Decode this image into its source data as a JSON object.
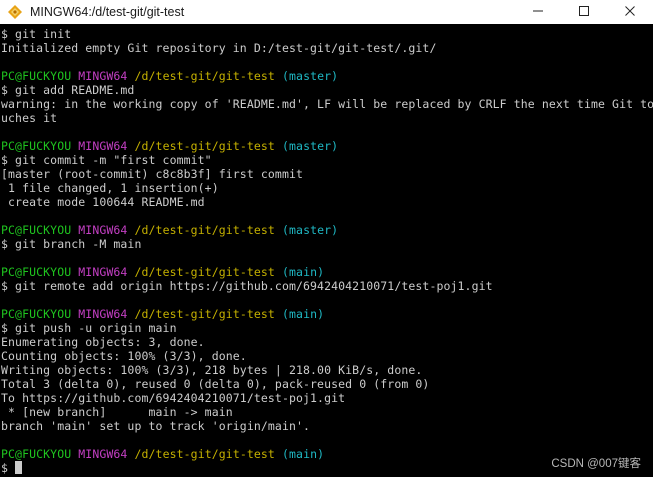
{
  "window": {
    "title": "MINGW64:/d/test-git/git-test",
    "controls": {
      "minimize": "minimize-icon",
      "maximize": "maximize-icon",
      "close": "close-icon"
    }
  },
  "terminal": {
    "colors": {
      "user": "#1fc41f",
      "system": "#c33fc3",
      "path": "#c4b000",
      "branch": "#1fb8c4",
      "text": "#cccccc"
    },
    "lines": {
      "l0": "$ git init",
      "l1": "Initialized empty Git repository in D:/test-git/git-test/.git/",
      "p1": {
        "user": "PC@FUCKYOU",
        "sys": "MINGW64",
        "path": "/d/test-git/git-test",
        "branch": "(master)"
      },
      "l4": "$ git add README.md",
      "l5": "warning: in the working copy of 'README.md', LF will be replaced by CRLF the next time Git to",
      "l6": "uches it",
      "p2": {
        "user": "PC@FUCKYOU",
        "sys": "MINGW64",
        "path": "/d/test-git/git-test",
        "branch": "(master)"
      },
      "l9": "$ git commit -m \"first commit\"",
      "l10": "[master (root-commit) c8c8b3f] first commit",
      "l11": " 1 file changed, 1 insertion(+)",
      "l12": " create mode 100644 README.md",
      "p3": {
        "user": "PC@FUCKYOU",
        "sys": "MINGW64",
        "path": "/d/test-git/git-test",
        "branch": "(master)"
      },
      "l15": "$ git branch -M main",
      "p4": {
        "user": "PC@FUCKYOU",
        "sys": "MINGW64",
        "path": "/d/test-git/git-test",
        "branch": "(main)"
      },
      "l18": "$ git remote add origin https://github.com/6942404210071/test-poj1.git",
      "p5": {
        "user": "PC@FUCKYOU",
        "sys": "MINGW64",
        "path": "/d/test-git/git-test",
        "branch": "(main)"
      },
      "l21": "$ git push -u origin main",
      "l22": "Enumerating objects: 3, done.",
      "l23": "Counting objects: 100% (3/3), done.",
      "l24": "Writing objects: 100% (3/3), 218 bytes | 218.00 KiB/s, done.",
      "l25": "Total 3 (delta 0), reused 0 (delta 0), pack-reused 0 (from 0)",
      "l26": "To https://github.com/6942404210071/test-poj1.git",
      "l27": " * [new branch]      main -> main",
      "l28": "branch 'main' set up to track 'origin/main'.",
      "p6": {
        "user": "PC@FUCKYOU",
        "sys": "MINGW64",
        "path": "/d/test-git/git-test",
        "branch": "(main)"
      },
      "l31": "$ "
    }
  },
  "watermark": "CSDN @007键客"
}
